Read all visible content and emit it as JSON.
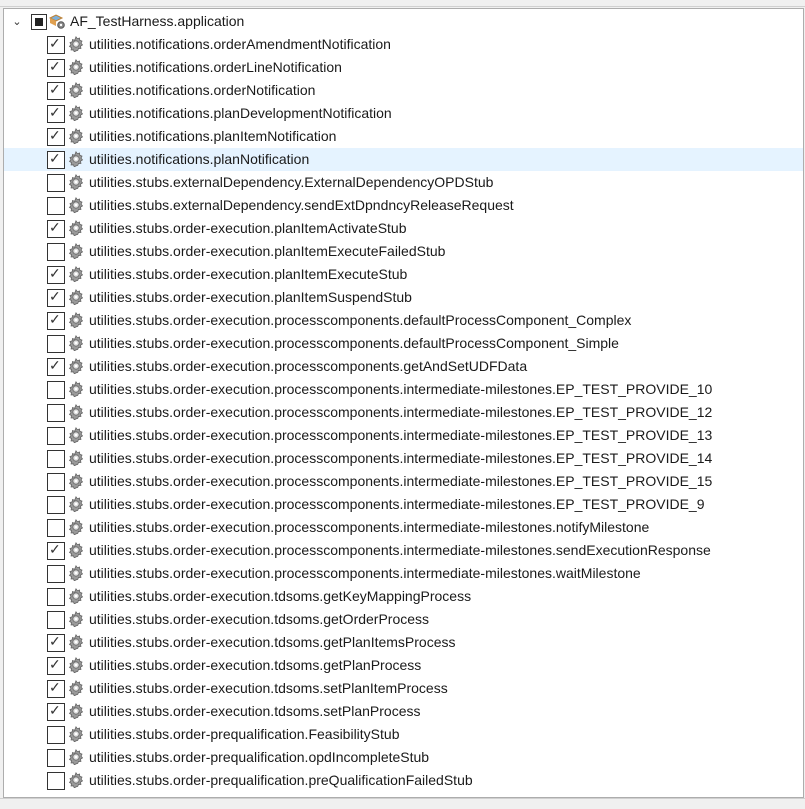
{
  "root": {
    "label": "AF_TestHarness.application",
    "state": "indeterminate",
    "expanded": true
  },
  "items": [
    {
      "label": "utilities.notifications.orderAmendmentNotification",
      "checked": true
    },
    {
      "label": "utilities.notifications.orderLineNotification",
      "checked": true
    },
    {
      "label": "utilities.notifications.orderNotification",
      "checked": true
    },
    {
      "label": "utilities.notifications.planDevelopmentNotification",
      "checked": true
    },
    {
      "label": "utilities.notifications.planItemNotification",
      "checked": true
    },
    {
      "label": "utilities.notifications.planNotification",
      "checked": true,
      "selected": true
    },
    {
      "label": "utilities.stubs.externalDependency.ExternalDependencyOPDStub",
      "checked": false
    },
    {
      "label": "utilities.stubs.externalDependency.sendExtDpndncyReleaseRequest",
      "checked": false
    },
    {
      "label": "utilities.stubs.order-execution.planItemActivateStub",
      "checked": true
    },
    {
      "label": "utilities.stubs.order-execution.planItemExecuteFailedStub",
      "checked": false
    },
    {
      "label": "utilities.stubs.order-execution.planItemExecuteStub",
      "checked": true
    },
    {
      "label": "utilities.stubs.order-execution.planItemSuspendStub",
      "checked": true
    },
    {
      "label": "utilities.stubs.order-execution.processcomponents.defaultProcessComponent_Complex",
      "checked": true
    },
    {
      "label": "utilities.stubs.order-execution.processcomponents.defaultProcessComponent_Simple",
      "checked": false
    },
    {
      "label": "utilities.stubs.order-execution.processcomponents.getAndSetUDFData",
      "checked": true
    },
    {
      "label": "utilities.stubs.order-execution.processcomponents.intermediate-milestones.EP_TEST_PROVIDE_10",
      "checked": false
    },
    {
      "label": "utilities.stubs.order-execution.processcomponents.intermediate-milestones.EP_TEST_PROVIDE_12",
      "checked": false
    },
    {
      "label": "utilities.stubs.order-execution.processcomponents.intermediate-milestones.EP_TEST_PROVIDE_13",
      "checked": false
    },
    {
      "label": "utilities.stubs.order-execution.processcomponents.intermediate-milestones.EP_TEST_PROVIDE_14",
      "checked": false
    },
    {
      "label": "utilities.stubs.order-execution.processcomponents.intermediate-milestones.EP_TEST_PROVIDE_15",
      "checked": false
    },
    {
      "label": "utilities.stubs.order-execution.processcomponents.intermediate-milestones.EP_TEST_PROVIDE_9",
      "checked": false
    },
    {
      "label": "utilities.stubs.order-execution.processcomponents.intermediate-milestones.notifyMilestone",
      "checked": false
    },
    {
      "label": "utilities.stubs.order-execution.processcomponents.intermediate-milestones.sendExecutionResponse",
      "checked": true
    },
    {
      "label": "utilities.stubs.order-execution.processcomponents.intermediate-milestones.waitMilestone",
      "checked": false
    },
    {
      "label": "utilities.stubs.order-execution.tdsoms.getKeyMappingProcess",
      "checked": false
    },
    {
      "label": "utilities.stubs.order-execution.tdsoms.getOrderProcess",
      "checked": false
    },
    {
      "label": "utilities.stubs.order-execution.tdsoms.getPlanItemsProcess",
      "checked": true
    },
    {
      "label": "utilities.stubs.order-execution.tdsoms.getPlanProcess",
      "checked": true
    },
    {
      "label": "utilities.stubs.order-execution.tdsoms.setPlanItemProcess",
      "checked": true
    },
    {
      "label": "utilities.stubs.order-execution.tdsoms.setPlanProcess",
      "checked": true
    },
    {
      "label": "utilities.stubs.order-prequalification.FeasibilityStub",
      "checked": false
    },
    {
      "label": "utilities.stubs.order-prequalification.opdIncompleteStub",
      "checked": false
    },
    {
      "label": "utilities.stubs.order-prequalification.preQualificationFailedStub",
      "checked": false
    }
  ],
  "colors": {
    "selection": "#e5f3ff",
    "check": "#333333"
  }
}
